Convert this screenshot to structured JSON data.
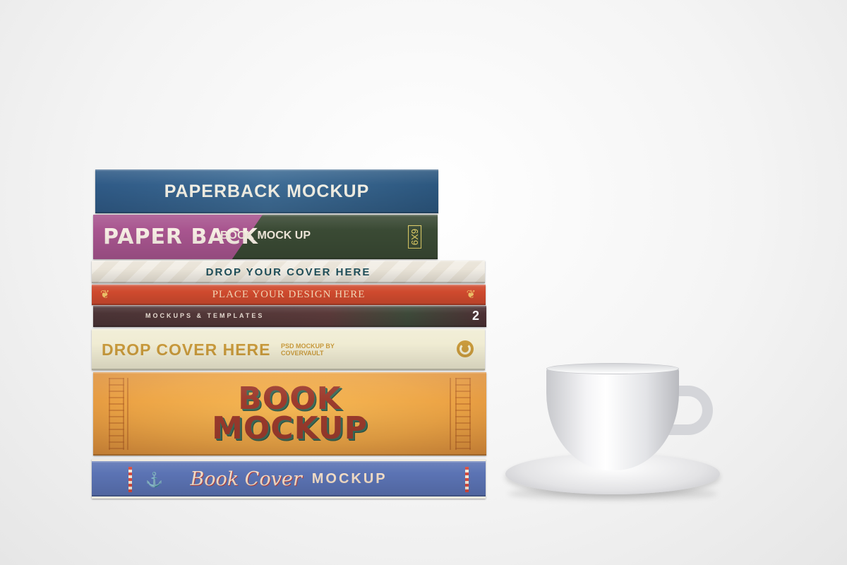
{
  "books": {
    "b1": {
      "title": "PAPERBACK MOCKUP"
    },
    "b2": {
      "title": "PAPER BACK",
      "subtitle": "BOOK MOCK UP",
      "size": "6X9"
    },
    "b3": {
      "title": "DROP YOUR COVER HERE"
    },
    "b4": {
      "title": "PLACE YOUR DESIGN HERE"
    },
    "b5": {
      "title": "MOCKUPS & TEMPLATES",
      "number": "2"
    },
    "b6": {
      "title": "DROP COVER HERE",
      "subtitle": "PSD MOCKUP BY COVERVAULT"
    },
    "b7": {
      "title_line1": "BOOK",
      "title_line2": "MOCKUP"
    },
    "b8": {
      "title_script": "Book Cover",
      "title_caps": "MOCKUP"
    }
  },
  "colors": {
    "background": "#f4f4f4",
    "book_blue": "#2f5a86",
    "book_pink": "#a8558f",
    "book_green": "#3a4a34",
    "book_red": "#cf4a2e",
    "book_brown": "#4b3436",
    "book_cream": "#f0ecd3",
    "book_orange": "#eda546",
    "book_periwinkle": "#5b73b4"
  }
}
